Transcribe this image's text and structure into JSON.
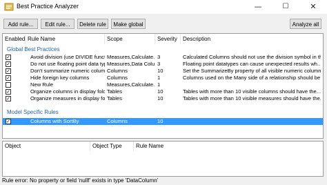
{
  "window": {
    "title": "Best Practice Analyzer",
    "minimize": "—",
    "maximize": "☐",
    "close": "✕"
  },
  "toolbar": {
    "add_rule": "Add rule...",
    "edit_rule": "Edit rule...",
    "delete_rule": "Delete rule",
    "make_global": "Make global",
    "analyze_all": "Analyze all"
  },
  "grid": {
    "headers": [
      "Enabled",
      "Rule Name",
      "Scope",
      "Severity",
      "Description"
    ],
    "groups": {
      "global": "Global Best Practices",
      "model": "Model Specific Rules"
    },
    "global_rows": [
      {
        "checked": true,
        "name": "Avoid division (use DIVIDE functi...",
        "scope": "Measures,Calculate...",
        "severity": "3",
        "description": "Calculated Columns should not use the division symbol in th..."
      },
      {
        "checked": true,
        "name": "Do not use floating point data types",
        "scope": "Measures,Data Colu...",
        "severity": "3",
        "description": "Floating point datatypes can cause unexpected results wh..."
      },
      {
        "checked": true,
        "name": "Don't summarize numeric columns",
        "scope": "Columns",
        "severity": "10",
        "description": "Set the SummarizeBy property of all visible numeric column..."
      },
      {
        "checked": true,
        "name": "Hide foreign key columns",
        "scope": "Columns",
        "severity": "1",
        "description": "Columns used on the Many side of a relationship should be..."
      },
      {
        "checked": false,
        "name": "New Rule",
        "scope": "Measures,Calculate...",
        "severity": "1",
        "description": ""
      },
      {
        "checked": true,
        "name": "Organize columns in display folders",
        "scope": "Tables",
        "severity": "10",
        "description": "Tables with more than 10 visible columns should have the..."
      },
      {
        "checked": true,
        "name": "Organize measures in display fold...",
        "scope": "Tables",
        "severity": "10",
        "description": "Tables with more than 10 visible measures should have the..."
      }
    ],
    "model_rows": [
      {
        "checked": true,
        "name": "Columns with SortBy",
        "scope": "Columns",
        "severity": "10",
        "description": ""
      }
    ]
  },
  "results": {
    "headers": [
      "Object",
      "Object Type",
      "Rule Name"
    ]
  },
  "status": {
    "text": "Rule error: No property or field 'nullf' exists in type 'DataColumn'"
  }
}
